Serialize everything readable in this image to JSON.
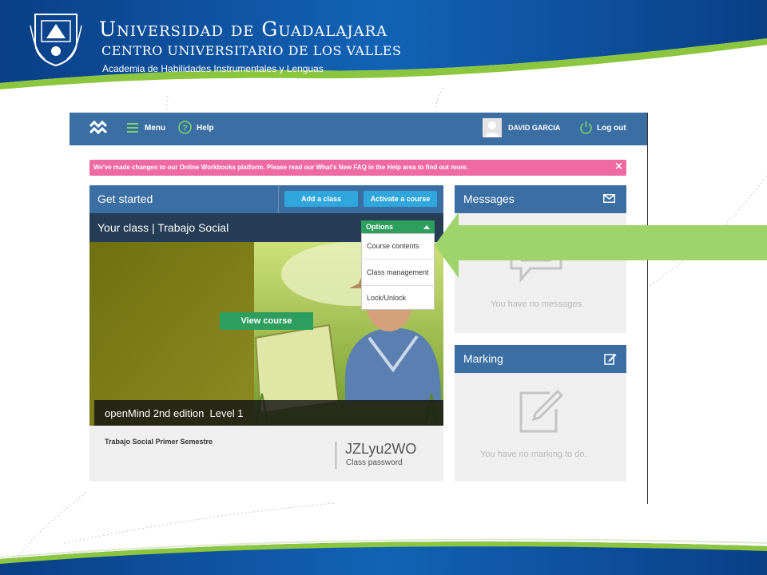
{
  "header": {
    "university": "Universidad de Guadalajara",
    "campus": "CENTRO UNIVERSITARIO DE LOS VALLES",
    "academy": "Academia de Habilidades Instrumentales y Lenguas"
  },
  "nav": {
    "menu_label": "Menu",
    "help_label": "Help",
    "user_name": "DAVID GARCIA",
    "logout_label": "Log out"
  },
  "banner": {
    "text": "We've made changes to our Online Workbooks platform. Please read our What's New FAQ in the Help area to find out more.",
    "close": "×"
  },
  "get_started": {
    "title": "Get started",
    "add_class": "Add a class",
    "activate_course": "Activate a course"
  },
  "your_class": {
    "title": "Your class | Trabajo Social",
    "options_label": "Options",
    "options_menu": [
      "Course contents",
      "Class management",
      "Lock/Unlock"
    ],
    "view_course": "View course",
    "course_name": "openMind 2nd edition  Level 1",
    "class_name": "Trabajo Social Primer Semestre",
    "password": "JZLyu2WO",
    "password_label": "Class password"
  },
  "messages": {
    "title": "Messages",
    "empty": "You have no messages."
  },
  "marking": {
    "title": "Marking",
    "empty": "You have no marking to do."
  },
  "colors": {
    "nav_blue": "#3b6fa3",
    "banner_pink": "#ef6aa3",
    "button_blue": "#2fa6dc",
    "options_green": "#2e9e5e",
    "arrow_green": "#9ed46a",
    "header_blue": "#0d4f9c"
  }
}
